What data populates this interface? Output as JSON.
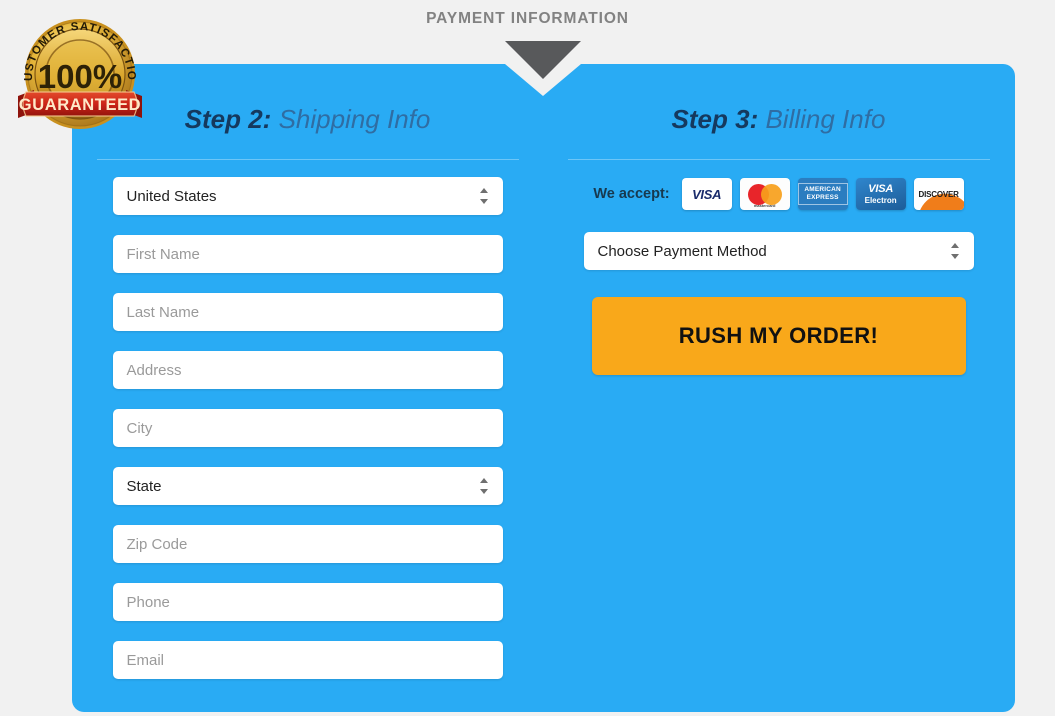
{
  "header": {
    "title": "PAYMENT INFORMATION",
    "arrow_icon": "triangle-down-icon"
  },
  "badge": {
    "arc_text": "CUSTOMER SATISFACTION",
    "center_text": "100%",
    "ribbon_text": "GUARANTEED",
    "name": "satisfaction-guarantee-badge"
  },
  "colors": {
    "panel_blue": "#29abf4",
    "page_background": "#f1f1f1",
    "cta_orange": "#f9a81a",
    "heading_dark": "#15395e",
    "heading_light": "#2f6da3",
    "arrow_gray": "#58595b"
  },
  "shipping": {
    "step_label": "Step 2:",
    "step_title": "Shipping Info",
    "fields": [
      {
        "name": "country-select",
        "value": "United States",
        "type": "select",
        "filled": true
      },
      {
        "name": "first-name-input",
        "value": "First Name",
        "type": "text",
        "filled": false
      },
      {
        "name": "last-name-input",
        "value": "Last Name",
        "type": "text",
        "filled": false
      },
      {
        "name": "address-input",
        "value": "Address",
        "type": "text",
        "filled": false
      },
      {
        "name": "city-input",
        "value": "City",
        "type": "text",
        "filled": false
      },
      {
        "name": "state-select",
        "value": "State",
        "type": "select",
        "filled": true
      },
      {
        "name": "zip-code-input",
        "value": "Zip Code",
        "type": "text",
        "filled": false
      },
      {
        "name": "phone-input",
        "value": "Phone",
        "type": "text",
        "filled": false
      },
      {
        "name": "email-input",
        "value": "Email",
        "type": "text",
        "filled": false
      }
    ]
  },
  "billing": {
    "step_label": "Step 3:",
    "step_title": "Billing Info",
    "accept_label": "We accept:",
    "cards": [
      {
        "name": "visa-card-icon",
        "label": "VISA"
      },
      {
        "name": "mastercard-card-icon",
        "label": "mastercard"
      },
      {
        "name": "amex-card-icon",
        "label": "AMERICAN EXPRESS"
      },
      {
        "name": "visa-electron-card-icon",
        "label": "VISA Electron"
      },
      {
        "name": "discover-card-icon",
        "label": "DISCOVER"
      }
    ],
    "payment_method": {
      "name": "payment-method-select",
      "value": "Choose Payment Method"
    },
    "cta_label": "RUSH MY ORDER!"
  }
}
